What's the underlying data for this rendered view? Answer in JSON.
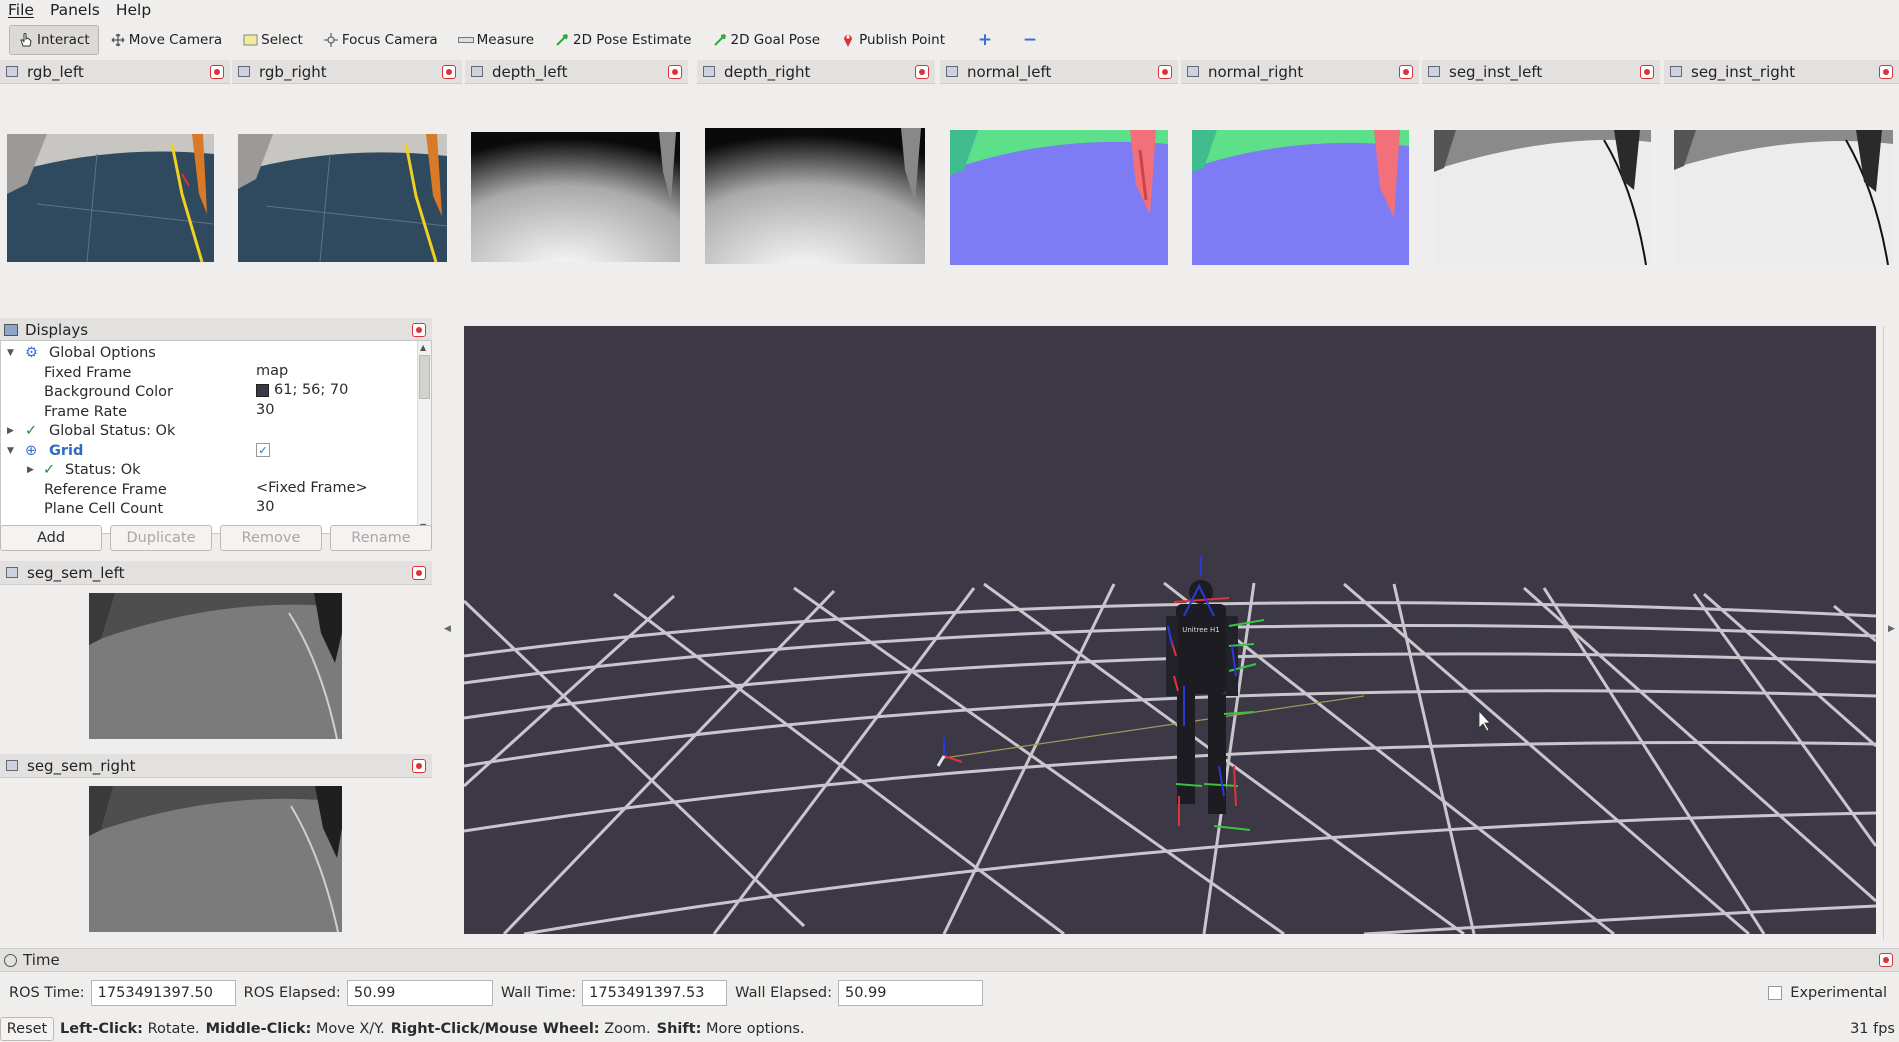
{
  "menu": [
    "File",
    "Panels",
    "Help"
  ],
  "toolbar": {
    "tools": [
      {
        "label": "Interact",
        "icon": "hand-cursor-icon",
        "active": true
      },
      {
        "label": "Move Camera",
        "icon": "move-camera-icon",
        "active": false
      },
      {
        "label": "Select",
        "icon": "select-box-icon",
        "active": false
      },
      {
        "label": "Focus Camera",
        "icon": "focus-camera-icon",
        "active": false
      },
      {
        "label": "Measure",
        "icon": "ruler-icon",
        "active": false
      },
      {
        "label": "2D Pose Estimate",
        "icon": "green-arrow-icon",
        "active": false
      },
      {
        "label": "2D Goal Pose",
        "icon": "green-arrow-icon",
        "active": false
      },
      {
        "label": "Publish Point",
        "icon": "red-pin-icon",
        "active": false
      }
    ],
    "add_icon": "plus-icon",
    "remove_icon": "minus-icon"
  },
  "camera_panels": [
    "rgb_left",
    "rgb_right",
    "depth_left",
    "depth_right",
    "normal_left",
    "normal_right",
    "seg_inst_left",
    "seg_inst_right"
  ],
  "displays": {
    "title": "Displays",
    "rows": [
      {
        "label": "Global Options",
        "value": ""
      },
      {
        "label": "Fixed Frame",
        "value": "map"
      },
      {
        "label": "Background Color",
        "value": "61; 56; 70"
      },
      {
        "label": "Frame Rate",
        "value": "30"
      },
      {
        "label": "Global Status: Ok",
        "value": ""
      },
      {
        "label": "Grid",
        "value": ""
      },
      {
        "label": "Status: Ok",
        "value": ""
      },
      {
        "label": "Reference Frame",
        "value": "<Fixed Frame>"
      },
      {
        "label": "Plane Cell Count",
        "value": "30"
      }
    ],
    "buttons": [
      "Add",
      "Duplicate",
      "Remove",
      "Rename"
    ],
    "background_color": "#3d3846",
    "grid_checked": true
  },
  "seg_panels": [
    "seg_sem_left",
    "seg_sem_right"
  ],
  "viewport": {
    "robot_label": "Unitree H1"
  },
  "time": {
    "title": "Time",
    "ros_time_label": "ROS Time:",
    "ros_time": "1753491397.50",
    "ros_elapsed_label": "ROS Elapsed:",
    "ros_elapsed": "50.99",
    "wall_time_label": "Wall Time:",
    "wall_time": "1753491397.53",
    "wall_elapsed_label": "Wall Elapsed:",
    "wall_elapsed": "50.99",
    "experimental_label": "Experimental"
  },
  "status": {
    "reset": "Reset",
    "hints": [
      {
        "key": "Left-Click:",
        "text": "Rotate."
      },
      {
        "key": "Middle-Click:",
        "text": "Move X/Y."
      },
      {
        "key": "Right-Click/Mouse Wheel:",
        "text": "Zoom."
      },
      {
        "key": "Shift:",
        "text": "More options."
      }
    ],
    "fps": "31 fps"
  }
}
